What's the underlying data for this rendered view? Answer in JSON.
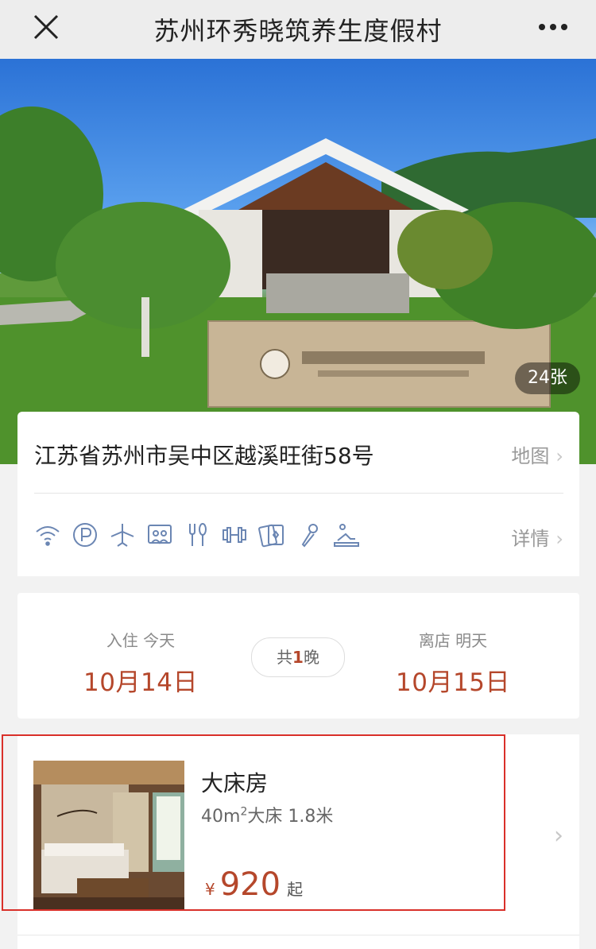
{
  "topbar": {
    "title": "苏州环秀晓筑养生度假村",
    "close_icon": "close-icon",
    "more_icon": "more-dots-icon"
  },
  "hero": {
    "photo_count": "24张"
  },
  "address": {
    "text": "江苏省苏州市吴中区越溪旺街58号",
    "map_label": "地图"
  },
  "amenities": {
    "items": [
      "wifi-icon",
      "parking-icon",
      "airplane-icon",
      "meeting-room-icon",
      "restaurant-icon",
      "gym-icon",
      "cards-icon",
      "karaoke-icon",
      "spa-icon"
    ],
    "detail_label": "详情"
  },
  "dates": {
    "checkin_label": "入住 今天",
    "checkin_date": "10月14日",
    "nights_prefix": "共",
    "nights_count": "1",
    "nights_suffix": "晚",
    "checkout_label": "离店 明天",
    "checkout_date": "10月15日"
  },
  "room": {
    "name": "大床房",
    "area": "40m",
    "area_sup": "2",
    "spec": "大床 1.8米",
    "currency": "¥",
    "price": "920",
    "price_suffix": "起"
  },
  "colors": {
    "accent": "#b5472b",
    "highlight_border": "#d9302a"
  }
}
